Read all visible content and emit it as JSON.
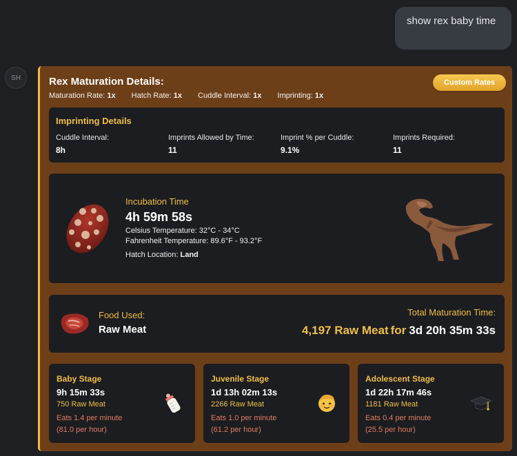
{
  "user_message": "show rex baby time",
  "bot_avatar": "SH",
  "card": {
    "title": "Rex Maturation Details:",
    "rates": [
      {
        "label": "Maturation Rate:",
        "value": "1x"
      },
      {
        "label": "Hatch Rate:",
        "value": "1x"
      },
      {
        "label": "Cuddle Interval:",
        "value": "1x"
      },
      {
        "label": "Imprinting:",
        "value": "1x"
      }
    ],
    "custom_rates_button": "Custom Rates",
    "accent_color": "#f1bf49",
    "card_color": "#6d3f19"
  },
  "imprinting": {
    "title": "Imprinting Details",
    "items": [
      {
        "label": "Cuddle Interval:",
        "value": "8h"
      },
      {
        "label": "Imprints Allowed by Time:",
        "value": "11"
      },
      {
        "label": "Imprint % per Cuddle:",
        "value": "9.1%"
      },
      {
        "label": "Imprints Required:",
        "value": "11"
      }
    ]
  },
  "incubation": {
    "label": "Incubation Time",
    "time": "4h 59m 58s",
    "celsius_label": "Celsius Temperature:",
    "celsius_value": "32°C - 34°C",
    "fahrenheit_label": "Fahrenheit Temperature:",
    "fahrenheit_value": "89.6°F - 93.2°F",
    "hatch_label": "Hatch Location:",
    "hatch_value": "Land",
    "egg_icon": "egg-icon",
    "creature_icon": "rex-icon"
  },
  "food": {
    "label": "Food Used:",
    "name": "Raw Meat",
    "icon": "raw-meat-icon",
    "total_label": "Total Maturation Time:",
    "total_amount": "4,197 Raw Meat",
    "for_text": "for",
    "total_time": "3d 20h 35m 33s"
  },
  "stages": [
    {
      "title": "Baby Stage",
      "time": "9h 15m 33s",
      "meat": "750 Raw Meat",
      "eats_min": "Eats 1.4 per minute",
      "eats_hour": "(81.0 per hour)",
      "icon": "baby-bottle-icon"
    },
    {
      "title": "Juvenile Stage",
      "time": "1d 13h 02m 13s",
      "meat": "2266 Raw Meat",
      "eats_min": "Eats 1.0 per minute",
      "eats_hour": "(61.2 per hour)",
      "icon": "child-face-icon"
    },
    {
      "title": "Adolescent Stage",
      "time": "1d 22h 17m 46s",
      "meat": "1181 Raw Meat",
      "eats_min": "Eats 0.4 per minute",
      "eats_hour": "(25.5 per hour)",
      "icon": "graduation-cap-icon"
    }
  ]
}
